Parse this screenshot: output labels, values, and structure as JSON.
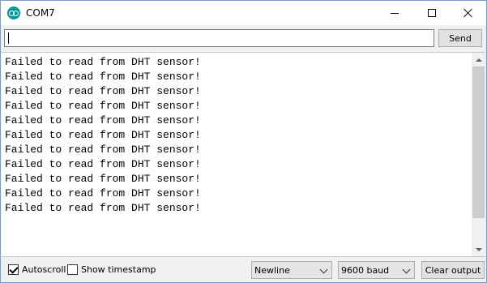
{
  "window": {
    "title": "COM7",
    "app_icon": "arduino-icon",
    "controls": [
      "minimize-icon",
      "maximize-icon",
      "close-icon"
    ]
  },
  "input": {
    "value": "",
    "send_label": "Send"
  },
  "output": {
    "lines": [
      "Failed to read from DHT sensor!",
      "Failed to read from DHT sensor!",
      "Failed to read from DHT sensor!",
      "Failed to read from DHT sensor!",
      "Failed to read from DHT sensor!",
      "Failed to read from DHT sensor!",
      "Failed to read from DHT sensor!",
      "Failed to read from DHT sensor!",
      "Failed to read from DHT sensor!",
      "Failed to read from DHT sensor!",
      "Failed to read from DHT sensor!"
    ]
  },
  "footer": {
    "autoscroll_label": "Autoscroll",
    "autoscroll_checked": true,
    "timestamp_label": "Show timestamp",
    "timestamp_checked": false,
    "line_ending_selected": "Newline",
    "baud_selected": "9600 baud",
    "clear_label": "Clear output"
  },
  "colors": {
    "accent": "#00979c",
    "chrome": "#f0f0f0"
  }
}
